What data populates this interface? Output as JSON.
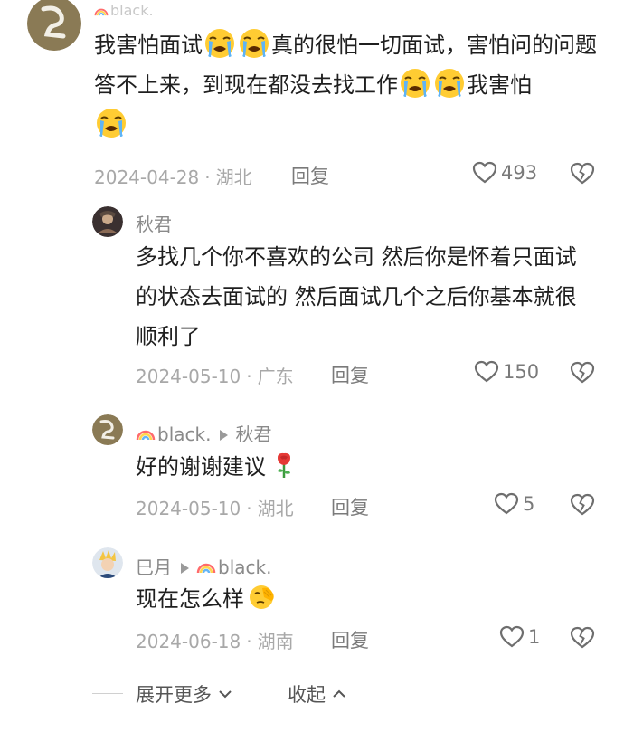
{
  "comments": [
    {
      "user": "black.",
      "text_parts": [
        "我害怕面试",
        "真的很怕一切面试，害怕问的问题答不上来，到现在都没去找工作",
        "我害怕"
      ],
      "date": "2024-04-28",
      "location": "湖北",
      "reply_label": "回复",
      "likes": "493"
    },
    {
      "user": "秋君",
      "text": "多找几个你不喜欢的公司 然后你是怀着只面试的状态去面试的 然后面试几个之后你基本就很顺利了",
      "date": "2024-05-10",
      "location": "广东",
      "reply_label": "回复",
      "likes": "150"
    },
    {
      "user": "black.",
      "reply_to": "秋君",
      "text": "好的谢谢建议",
      "date": "2024-05-10",
      "location": "湖北",
      "reply_label": "回复",
      "likes": "5"
    },
    {
      "user": "巳月",
      "reply_to": "black.",
      "text": "现在怎么样",
      "date": "2024-06-18",
      "location": "湖南",
      "reply_label": "回复",
      "likes": "1"
    }
  ],
  "footer": {
    "expand_label": "展开更多",
    "collapse_label": "收起"
  },
  "icons": {
    "like": "heart-outline-icon",
    "dislike": "broken-heart-icon",
    "crying": "loudly-crying-face-emoji",
    "rose": "rose-emoji",
    "facepalm": "face-with-hand-emoji",
    "rainbow": "rainbow-emoji"
  }
}
